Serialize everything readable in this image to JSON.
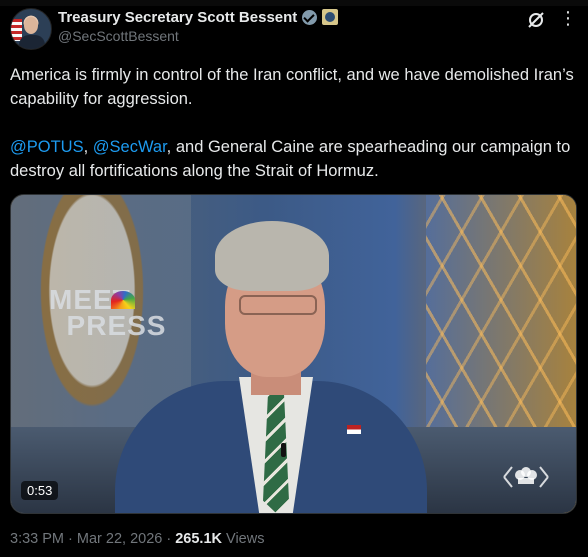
{
  "author": {
    "display_name": "Treasury Secretary Scott Bessent",
    "handle": "@SecScottBessent",
    "verified_badge": "gray-verified-badge-icon",
    "affiliate_badge": "treasury-seal-icon"
  },
  "tweet": {
    "paragraph1": "America is firmly in control of the Iran conflict, and we have demolished Iran’s capability for aggression.",
    "mention1": "@POTUS",
    "sep1": ", ",
    "mention2": "@SecWar",
    "paragraph2_rest": ", and General Caine are spearheading our campaign to destroy all fortifications along the Strait of Hormuz."
  },
  "media": {
    "duration": "0:53",
    "background_text": "MEET THE PRESS",
    "watermark": "nbc-peacock-logo"
  },
  "meta": {
    "time": "3:33 PM",
    "separator1": " · ",
    "date": "Mar 22, 2026",
    "separator2": " · ",
    "views_count": "265.1K",
    "views_label": " Views"
  },
  "colors": {
    "background": "#000000",
    "text": "#e7e9ea",
    "secondary": "#71767b",
    "link": "#1d9bf0"
  }
}
